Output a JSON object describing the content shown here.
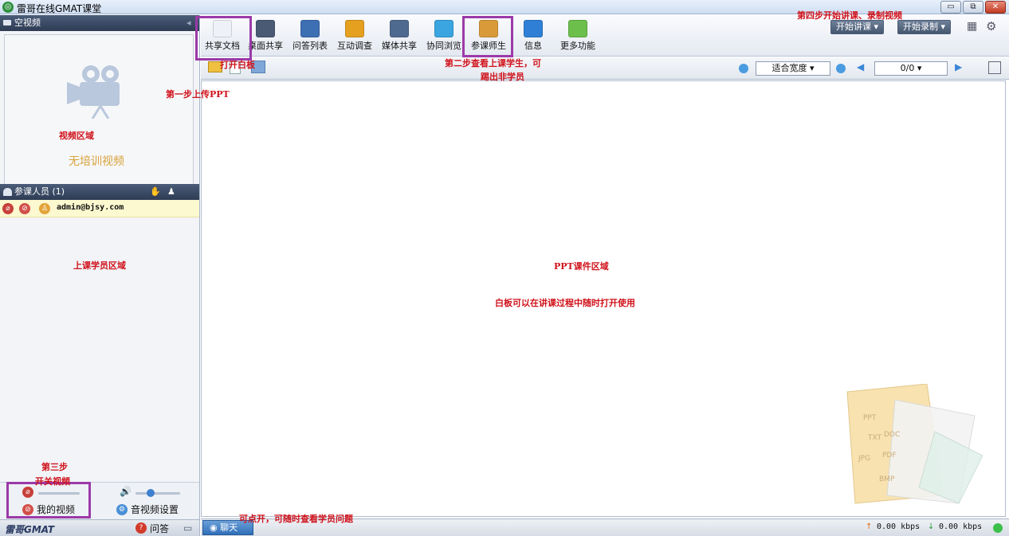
{
  "window": {
    "title": "雷哥在线GMAT课堂",
    "min": "▭",
    "max": "⧉",
    "close": "✕"
  },
  "left_panel": {
    "video_header": "空视频",
    "video_area_note": "视频区域",
    "no_video_text": "无培训视频",
    "participants_header": "参课人员 (1)",
    "participant_name": "admin@bjsy.com",
    "student_area_note": "上课学员区域",
    "my_video_label": "我的视频",
    "av_settings_label": "音视频设置",
    "logo_text": "雷哥GMAT",
    "qa_label": "问答"
  },
  "toolbar": {
    "buttons": [
      {
        "label": "共享文档",
        "icon": "document-icon",
        "color": "#eef2f8"
      },
      {
        "label": "桌面共享",
        "icon": "desktop-icon",
        "color": "#4a5a74"
      },
      {
        "label": "问答列表",
        "icon": "qa-list-icon",
        "color": "#3d6fb3"
      },
      {
        "label": "互动调查",
        "icon": "bar-chart-icon",
        "color": "#e5a020"
      },
      {
        "label": "媒体共享",
        "icon": "media-icon",
        "color": "#4f6a8f"
      },
      {
        "label": "协同浏览",
        "icon": "ie-icon",
        "color": "#3aa5e0"
      },
      {
        "label": "参课师生",
        "icon": "users-icon",
        "color": "#d99a3a"
      },
      {
        "label": "信息",
        "icon": "info-icon",
        "color": "#2f7fd6"
      },
      {
        "label": "更多功能",
        "icon": "grid-icon",
        "color": "#6bbf4a"
      }
    ],
    "start_lecture": "开始讲课",
    "start_record": "开始录制"
  },
  "sub_toolbar": {
    "fit_option": "适合宽度",
    "page_indicator": "0/0"
  },
  "status": {
    "chat_label": "聊天",
    "upload_rate": "0.00 kbps",
    "download_rate": "0.00 kbps"
  },
  "annotations": {
    "step1": "第一步上传PPT",
    "open_whiteboard": "打开白板",
    "step2_line1": "第二步查看上课学生，可",
    "step2_line2": "踢出非学员",
    "step3_line1": "第三步",
    "step3_line2": "开关视频",
    "step4": "第四步开始讲课、录制视频",
    "ppt_area": "PPT课件区域",
    "whiteboard_note": "白板可以在讲课过程中随时打开使用",
    "chat_note": "可点开，可随时查看学员问题"
  },
  "decor": {
    "file_types": [
      "PPT",
      "TXT",
      "DOC",
      "JPG",
      "PDF",
      "BMP"
    ]
  },
  "colors": {
    "annotation": "#d0121b",
    "highlight": "#9b3aa8",
    "panel_header": "#2e3c54"
  }
}
